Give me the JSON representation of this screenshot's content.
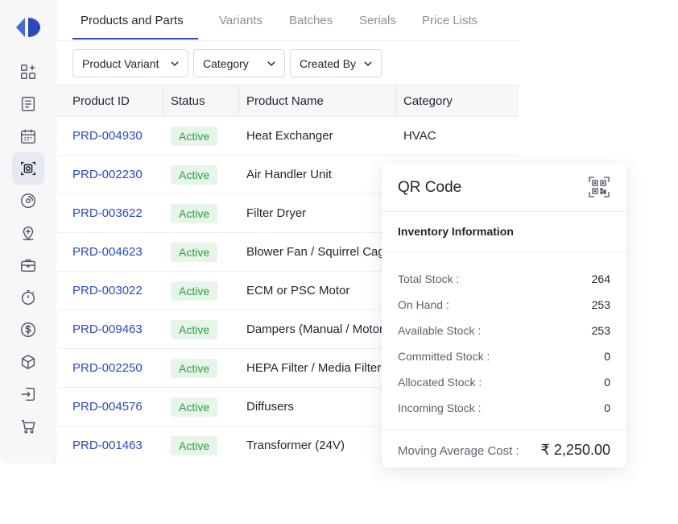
{
  "sidebar": {
    "items": [
      {
        "icon": "apps-add-icon"
      },
      {
        "icon": "document-list-icon"
      },
      {
        "icon": "calendar-icon"
      },
      {
        "icon": "product-scan-icon",
        "active": true
      },
      {
        "icon": "disc-icon"
      },
      {
        "icon": "location-add-icon"
      },
      {
        "icon": "briefcase-icon"
      },
      {
        "icon": "stopwatch-icon"
      },
      {
        "icon": "dollar-circle-icon"
      },
      {
        "icon": "package-box-icon"
      },
      {
        "icon": "import-icon"
      },
      {
        "icon": "cart-icon"
      }
    ]
  },
  "tabs": [
    "Products and Parts",
    "Variants",
    "Batches",
    "Serials",
    "Price Lists"
  ],
  "filters": [
    "Product Variant",
    "Category",
    "Created By"
  ],
  "table": {
    "columns": [
      "Product ID",
      "Status",
      "Product Name",
      "Category"
    ],
    "rows": [
      {
        "id": "PRD-004930",
        "status": "Active",
        "name": "Heat Exchanger",
        "category": "HVAC"
      },
      {
        "id": "PRD-002230",
        "status": "Active",
        "name": "Air Handler Unit",
        "category": ""
      },
      {
        "id": "PRD-003622",
        "status": "Active",
        "name": "Filter Dryer",
        "category": ""
      },
      {
        "id": "PRD-004623",
        "status": "Active",
        "name": "Blower Fan / Squirrel Cage",
        "category": ""
      },
      {
        "id": "PRD-003022",
        "status": "Active",
        "name": "ECM or PSC Motor",
        "category": ""
      },
      {
        "id": "PRD-009463",
        "status": "Active",
        "name": "Dampers (Manual / Motorized)",
        "category": ""
      },
      {
        "id": "PRD-002250",
        "status": "Active",
        "name": "HEPA Filter / Media Filter",
        "category": ""
      },
      {
        "id": "PRD-004576",
        "status": "Active",
        "name": "Diffusers",
        "category": ""
      },
      {
        "id": "PRD-001463",
        "status": "Active",
        "name": "Transformer (24V)",
        "category": ""
      }
    ]
  },
  "panel": {
    "title": "QR Code",
    "subtitle": "Inventory Information",
    "stats": [
      {
        "label": "Total Stock :",
        "value": "264"
      },
      {
        "label": "On Hand :",
        "value": "253"
      },
      {
        "label": "Available Stock :",
        "value": "253"
      },
      {
        "label": "Committed Stock :",
        "value": "0"
      },
      {
        "label": "Allocated Stock :",
        "value": "0"
      },
      {
        "label": "Incoming Stock :",
        "value": "0"
      }
    ],
    "mac_label": "Moving Average Cost :",
    "mac_value": "₹ 2,250.00"
  },
  "colors": {
    "accent": "#2b4bbd",
    "status_bg": "#e6f5e8",
    "status_text": "#2e9a45"
  }
}
